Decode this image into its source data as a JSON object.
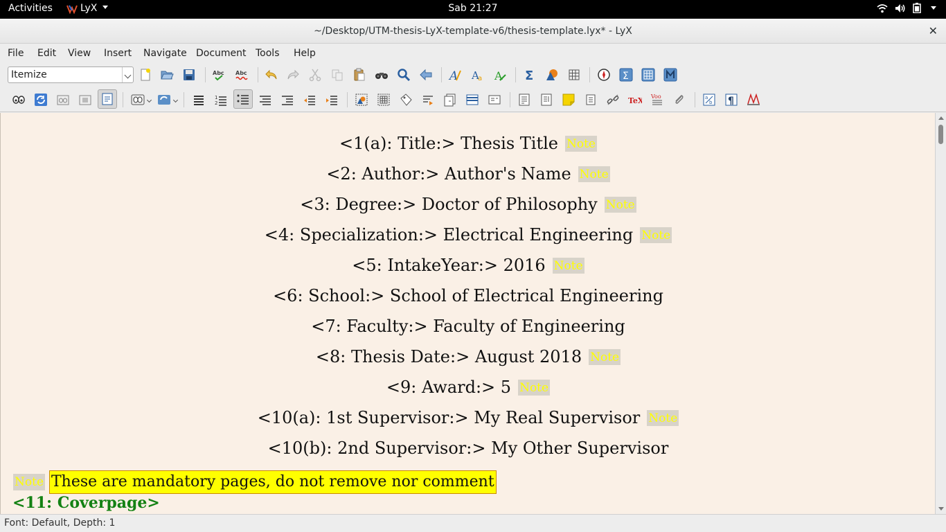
{
  "topbar": {
    "activities": "Activities",
    "app_name": "LyX",
    "clock": "Sab 21:27"
  },
  "window": {
    "title": "~/Desktop/UTM-thesis-LyX-template-v6/thesis-template.lyx* - LyX",
    "close": "✕"
  },
  "menu": [
    "File",
    "Edit",
    "View",
    "Insert",
    "Navigate",
    "Document",
    "Tools",
    "Help"
  ],
  "toolbar": {
    "layout_combo": "Itemize"
  },
  "document": {
    "note_label": "Note",
    "lines": [
      {
        "text": "<1(a): Title:> Thesis Title",
        "has_note": true
      },
      {
        "text": "<2: Author:> Author's Name",
        "has_note": true
      },
      {
        "text": "<3: Degree:> Doctor of Philosophy",
        "has_note": true
      },
      {
        "text": "<4: Specialization:> Electrical Engineering",
        "has_note": true
      },
      {
        "text": "<5: IntakeYear:> 2016",
        "has_note": true
      },
      {
        "text": "<6: School:> School of Electrical Engineering",
        "has_note": false
      },
      {
        "text": "<7: Faculty:> Faculty of Engineering",
        "has_note": false
      },
      {
        "text": "<8: Thesis Date:> August 2018",
        "has_note": true
      },
      {
        "text": "<9: Award:> 5",
        "has_note": true
      },
      {
        "text": "<10(a): 1st Supervisor:> My Real Supervisor",
        "has_note": true
      },
      {
        "text": "<10(b): 2nd Supervisor:> My Other Supervisor",
        "has_note": false
      }
    ],
    "mandatory_note": "These are mandatory pages, do not remove nor comment",
    "coverpage_label": "<11: Coverpage>"
  },
  "statusbar": {
    "text": "Font: Default, Depth: 1"
  },
  "colors": {
    "doc_background": "#faf0e6",
    "note_text": "#ffff00",
    "note_background": "#d8d3c9",
    "highlight": "#ffff00",
    "coverpage": "#138113"
  }
}
